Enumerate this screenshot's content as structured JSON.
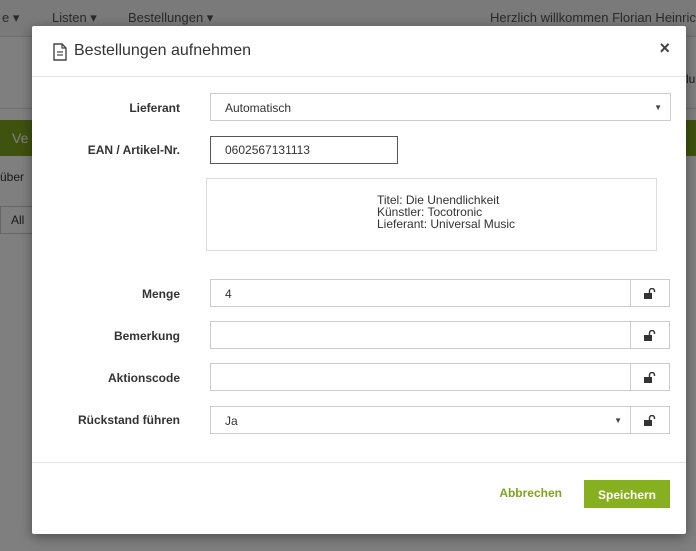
{
  "background": {
    "nav": {
      "item1": "e ▾",
      "item2": "Listen ▾",
      "item3": "Bestellungen ▾",
      "welcome": "Herzlich willkommen Florian Heinrich"
    },
    "subbar_cut": "lu",
    "green_bar": "Ve",
    "small_text": "über",
    "button_cut": "All"
  },
  "modal": {
    "title": "Bestellungen aufnehmen",
    "close": "×",
    "fields": {
      "supplier": {
        "label": "Lieferant",
        "value": "Automatisch"
      },
      "ean": {
        "label": "EAN / Artikel-Nr.",
        "value": "0602567131113"
      },
      "quantity": {
        "label": "Menge",
        "value": "4"
      },
      "remark": {
        "label": "Bemerkung",
        "value": ""
      },
      "promo_code": {
        "label": "Aktionscode",
        "value": ""
      },
      "backorder": {
        "label": "Rückstand führen",
        "value": "Ja"
      }
    },
    "info": {
      "title": "Titel: Die Unendlichkeit",
      "artist": "Künstler: Tocotronic",
      "supplier": "Lieferant: Universal Music"
    },
    "footer": {
      "cancel": "Abbrechen",
      "save": "Speichern"
    }
  },
  "colors": {
    "accent": "#86b01f",
    "link": "#7fa51d"
  }
}
